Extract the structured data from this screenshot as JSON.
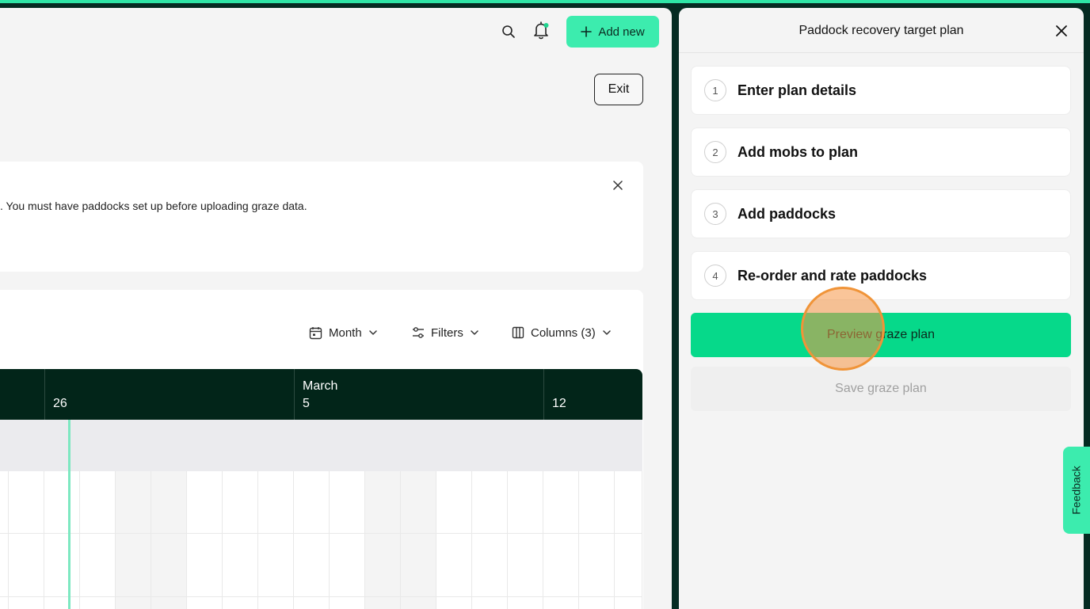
{
  "header": {
    "search_icon": "search-icon",
    "bell_icon": "bell-icon",
    "add_new_label": "Add new",
    "exit_label": "Exit"
  },
  "notice": {
    "text": ". You must have paddocks set up before uploading graze data."
  },
  "calendar": {
    "toolbar": {
      "view_label": "Month",
      "filters_label": "Filters",
      "columns_label": "Columns (3)"
    },
    "dates": [
      {
        "month": "",
        "day": "26"
      },
      {
        "month": "March",
        "day": "5"
      },
      {
        "month": "",
        "day": "12"
      }
    ]
  },
  "side_panel": {
    "title": "Paddock recovery target plan",
    "steps": [
      {
        "number": "1",
        "label": "Enter plan details"
      },
      {
        "number": "2",
        "label": "Add mobs to plan"
      },
      {
        "number": "3",
        "label": "Add paddocks"
      },
      {
        "number": "4",
        "label": "Re-order and rate paddocks"
      }
    ],
    "preview_label": "Preview graze plan",
    "save_label": "Save graze plan"
  },
  "feedback_label": "Feedback",
  "colors": {
    "accent": "#3cecae",
    "primary_button": "#06d98a",
    "calendar_header": "#022519",
    "app_frame": "#052b22"
  }
}
